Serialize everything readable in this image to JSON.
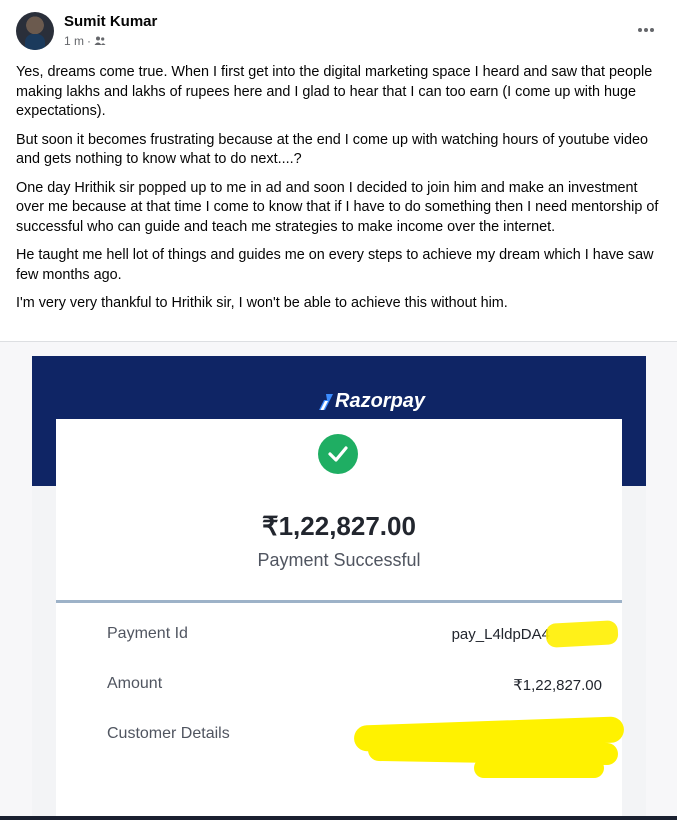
{
  "post": {
    "author": "Sumit Kumar",
    "time": "1 m",
    "separator": "·",
    "audience_icon": "friends-icon",
    "more_icon": "more-dots-icon",
    "paragraphs": [
      "Yes, dreams come true. When I first get into the digital marketing space I heard and saw that people making lakhs and lakhs of rupees here and I glad to hear that I can too earn (I come up with huge expectations).",
      "But soon it becomes frustrating because at the end I come up with watching hours of youtube video and gets nothing to know what to do next....?",
      "One day Hrithik sir popped up to me in ad and soon I decided to join him and make an investment over me because at that time I come to know that if I have to do something then I need mentorship of successful who can guide and teach me strategies to make income over the internet.",
      "He taught me hell lot of things and guides me on every steps to achieve my dream which I have saw few months ago.",
      "I'm very very thankful to Hrithik sir, I won't be able to achieve this without him."
    ]
  },
  "receipt": {
    "brand": "Razorpay",
    "amount_big": "₹1,22,827.00",
    "status": "Payment Successful",
    "rows": [
      {
        "label": "Payment Id",
        "value": "pay_L4ldpDA4"
      },
      {
        "label": "Amount",
        "value": "₹1,22,827.00"
      },
      {
        "label": "Customer Details",
        "value": ""
      }
    ],
    "colors": {
      "header": "#0f2565",
      "success": "#1fae63",
      "highlight": "#fff200"
    }
  }
}
